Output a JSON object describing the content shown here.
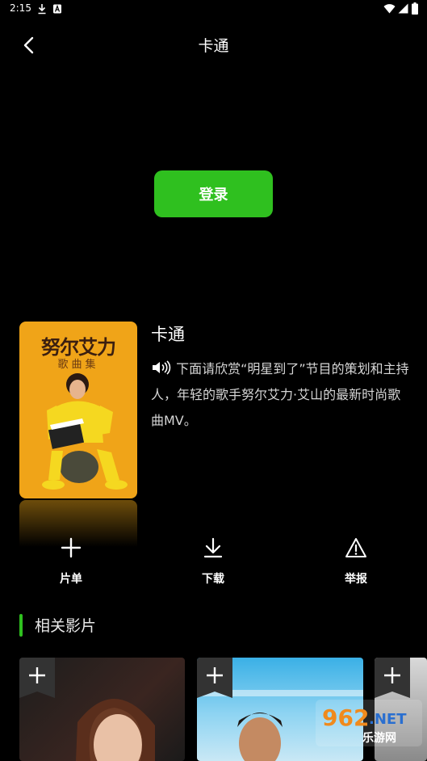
{
  "status_bar": {
    "time": "2:15"
  },
  "header": {
    "title": "卡通"
  },
  "login": {
    "label": "登录"
  },
  "video": {
    "poster_title": "努尔艾力",
    "poster_subtitle": "歌曲集",
    "title": "卡通",
    "description": "下面请欣赏“明星到了”节目的策划和主持人，年轻的歌手努尔艾力·艾山的最新时尚歌曲MV。"
  },
  "actions": [
    {
      "label": "片单",
      "icon": "plus-icon"
    },
    {
      "label": "下载",
      "icon": "download-icon"
    },
    {
      "label": "举报",
      "icon": "warning-icon"
    }
  ],
  "related": {
    "heading": "相关影片"
  },
  "watermark": {
    "site": "962.NET",
    "tagline": "乐游网"
  },
  "colors": {
    "accent": "#2fc01f",
    "background": "#000000"
  }
}
